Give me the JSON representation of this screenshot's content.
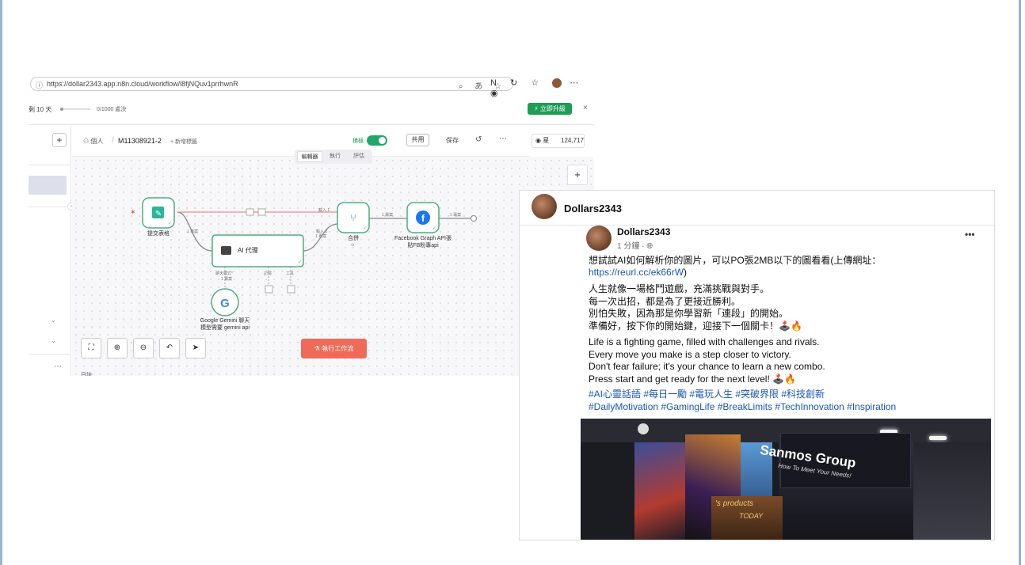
{
  "browser": {
    "url": "https://dollar2343.app.n8n.cloud/workflow/l8fjNQuv1prrhwnR"
  },
  "n8n": {
    "trial_days": "剩 10 天",
    "trial_count": "0/1000 處決",
    "upgrade_label": "立即升級",
    "close": "×",
    "breadcrumb": {
      "owner": "個人",
      "separator": "/",
      "workflow_name": "M11308921-2",
      "add_tag": "+ 新增標籤"
    },
    "active_label": "積極",
    "share_label": "共用",
    "save_label": "保存",
    "github_star": "星",
    "github_count": "124,717",
    "tabs": [
      "編輯器",
      "執行",
      "評估"
    ],
    "nodes": {
      "form": "提交表格",
      "agent": "AI 代理",
      "merge": "合併",
      "merge_sub": "⊙",
      "facebook": "Facebook Graph API張\n貼FB粉專api",
      "gemini": "Google Gemini 聊天\n模型需要 gemini api"
    },
    "edge_labels": {
      "form_to_agent": "1 專案",
      "agent_to_merge": "1 專案",
      "merge_in1": "輸入 1",
      "merge_in2": "輸入 2",
      "merge_to_fb": "1 專案",
      "fb_out": "1 專案",
      "chat_model": "聊天模式*",
      "chat_model_items": "1 專案",
      "memory": "記憶",
      "tool": "工具"
    },
    "run_label": "執行工作流",
    "bottom_label": "日誌"
  },
  "facebook": {
    "page_name": "Dollars2343",
    "author": "Dollars2343",
    "time": "1 分鐘 · ",
    "intro": "想試試AI如何解析你的圖片，可以PO張2MB以下的圖看看(上傳網址：",
    "link": "https://reurl.cc/ek66rW",
    "link_close": ")",
    "zh_lines": [
      "人生就像一場格鬥遊戲，充滿挑戰與對手。",
      "每一次出招，都是為了更接近勝利。",
      "別怕失敗，因為那是你學習新「連段」的開始。",
      "準備好，按下你的開始鍵，迎接下一個關卡！🕹️🔥"
    ],
    "en_lines": [
      "Life is a fighting game, filled with challenges and rivals.",
      "Every move you make is a step closer to victory.",
      "Don't fear failure; it's your chance to learn a new combo.",
      "Press start and get ready for the next level! 🕹️🔥"
    ],
    "tags_zh": "#AI心靈話語 #每日一勵 #電玩人生 #突破界限 #科技創新",
    "tags_en": "#DailyMotivation #GamingLife #BreakLimits #TechInnovation #Inspiration",
    "photo": {
      "sign_title": "Sanmos Group",
      "sign_sub": "How To Meet Your Needs!",
      "screen_text": "'s products",
      "screen_text2": "TODAY"
    }
  }
}
